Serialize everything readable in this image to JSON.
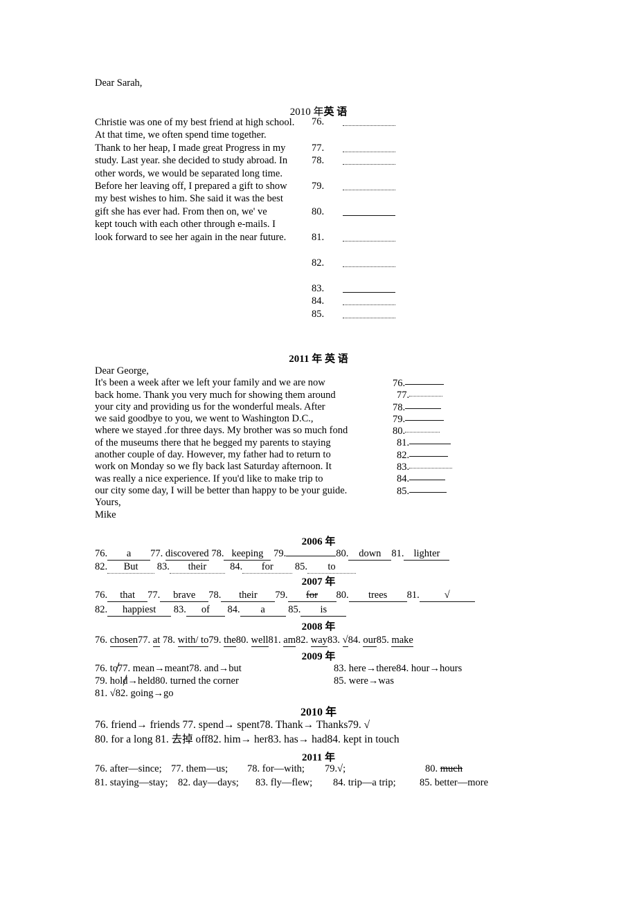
{
  "document": {
    "salutation_2010": "Dear Sarah,",
    "title_2010_year": "2010 年",
    "title_2010_subject": "英  语",
    "title_2011": "2011 年 英  语",
    "salutation_2011": "Dear George,",
    "closing_2011_yours": "Yours,",
    "closing_2011_name": "Mike"
  },
  "cloze_2010": {
    "lines": [
      "Christie was one of my best friend at high school.",
      "At that time, we often spend time together.",
      "Thank to her heap, I made great Progress in my",
      "study. Last year. she decided to study abroad. In",
      "other words, we would be separated long time.",
      "Before her leaving off, I prepared a gift to show",
      "my best wishes to him. She said it was the best",
      "gift she has ever had. From then on, we' ve",
      "kept touch with each other through e-mails. I",
      "look forward to see her again in the near future."
    ],
    "blank_numbers": [
      "76.",
      "77.",
      "78.",
      "79.",
      "80.",
      "81.",
      "82.",
      "83.",
      "84.",
      "85."
    ]
  },
  "cloze_2011": {
    "lines": [
      "It's been a week after we left your family and we are now",
      "back home. Thank you very much for showing them around",
      "your city and providing us for the wonderful meals. After",
      "we said goodbye to you, we went to Washington D.C.,",
      "where we stayed  .for three days. My brother was so much fond",
      "of the museums there that he begged my parents to staying",
      "another couple of day. However, my father had to return to",
      "work on Monday so we fly back last Saturday afternoon. It",
      "was really a nice experience. If you'd like to make trip to",
      "our city some day, I will be better than happy to be your guide."
    ],
    "blank_numbers": [
      "76.",
      "77.",
      "78.",
      "79.",
      "80.",
      "81.",
      "82.",
      "83.",
      "84.",
      "85."
    ]
  },
  "answer_keys": [
    {
      "year_title": "2006 年",
      "rows": [
        [
          {
            "n": "76.",
            "a": "a"
          },
          {
            "n": "77.",
            "a": "discovered",
            "plain": true
          },
          {
            "n": "78.",
            "a": "keeping"
          },
          {
            "n": "79.",
            "a": ""
          },
          {
            "n": "80.",
            "a": "down"
          },
          {
            "n": "81.",
            "a": "lighter"
          }
        ],
        [
          {
            "n": "82.",
            "a": "But"
          },
          {
            "n": "83.",
            "a": "their"
          },
          {
            "n": "84.",
            "a": "for"
          },
          {
            "n": "85.",
            "a": "to"
          }
        ]
      ]
    },
    {
      "year_title": "2007 年",
      "rows": [
        [
          {
            "n": "76.",
            "a": "that"
          },
          {
            "n": "77.",
            "a": "brave"
          },
          {
            "n": "78.",
            "a": "their"
          },
          {
            "n": "79.",
            "a": "for",
            "strike": true
          },
          {
            "n": "80.",
            "a": "trees"
          },
          {
            "n": "81.",
            "a": "√"
          }
        ],
        [
          {
            "n": "82.",
            "a": "happiest"
          },
          {
            "n": "83.",
            "a": "of"
          },
          {
            "n": "84.",
            "a": "a"
          },
          {
            "n": "85.",
            "a": "is"
          }
        ]
      ]
    },
    {
      "year_title": "2008 年",
      "inline": "76. chosen77. at 78. with/ to79. the80. well81. am82. way83. √84. our85. make",
      "inline_items": [
        {
          "n": "76.",
          "a": "chosen"
        },
        {
          "n": "77.",
          "a": "at"
        },
        {
          "n": "78.",
          "a": "with/ to"
        },
        {
          "n": "79.",
          "a": "the"
        },
        {
          "n": "80.",
          "a": "well"
        },
        {
          "n": "81.",
          "a": "am"
        },
        {
          "n": "82.",
          "a": "way"
        },
        {
          "n": "83.",
          "a": "√"
        },
        {
          "n": "84.",
          "a": "our"
        },
        {
          "n": "85.",
          "a": "make"
        }
      ]
    },
    {
      "year_title": "2009 年",
      "left_lines": [
        "76. to77. mean→meant78. and→but",
        "79. hold→held80. turned the corner",
        "81. √82. going→go"
      ],
      "right_lines": [
        "83. here→there84. hour→hours",
        "85. were→was"
      ]
    },
    {
      "year_title": "2010 年",
      "lines": [
        "76. friend→ friends    77. spend→ spent78. Thank→ Thanks79. √",
        "80. for a long 81. 去掉 off82. him→ her83. has→ had84. kept in touch"
      ]
    },
    {
      "year_title": "2011 年",
      "cells": [
        [
          {
            "t": "76. after—since;"
          },
          {
            "t": "77. them—us;"
          },
          {
            "t": "78. for—with;"
          },
          {
            "t": "79.√;"
          },
          {
            "pre": "80. ",
            "t": "much",
            "strike": true
          }
        ],
        [
          {
            "t": "81. staying—stay;"
          },
          {
            "t": "82. day—days;"
          },
          {
            "t": "83. fly—flew;"
          },
          {
            "t": "84. trip—a trip;"
          },
          {
            "t": "85. better—more"
          }
        ]
      ]
    }
  ]
}
